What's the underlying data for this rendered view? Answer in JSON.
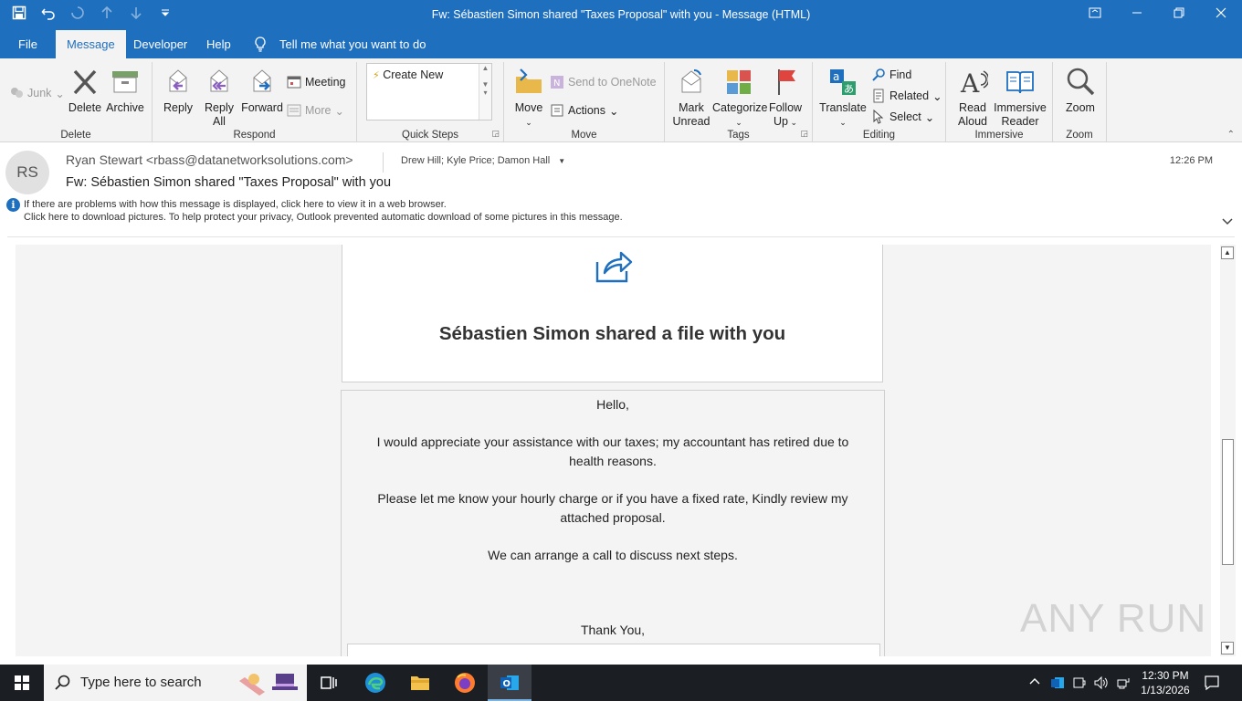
{
  "window": {
    "title": "Fw: Sébastien Simon shared \"Taxes Proposal\" with you  -  Message (HTML)"
  },
  "tabs": [
    {
      "label": "File"
    },
    {
      "label": "Message"
    },
    {
      "label": "Developer"
    },
    {
      "label": "Help"
    },
    {
      "label": "Tell me what you want to do"
    }
  ],
  "ribbon": {
    "groups": {
      "delete": "Delete",
      "respond": "Respond",
      "quicksteps": "Quick Steps",
      "move": "Move",
      "tags": "Tags",
      "editing": "Editing",
      "immersive": "Immersive",
      "zoom": "Zoom"
    },
    "buttons": {
      "junk": "Junk",
      "delete": "Delete",
      "archive": "Archive",
      "reply": "Reply",
      "reply_all_1": "Reply",
      "reply_all_2": "All",
      "forward": "Forward",
      "meeting": "Meeting",
      "more": "More",
      "create_new": "Create New",
      "move": "Move",
      "send_onenote": "Send to OneNote",
      "actions": "Actions",
      "mark_unread_1": "Mark",
      "mark_unread_2": "Unread",
      "categorize": "Categorize",
      "follow_up_1": "Follow",
      "follow_up_2": "Up",
      "translate": "Translate",
      "find": "Find",
      "related": "Related",
      "select": "Select",
      "read_aloud_1": "Read",
      "read_aloud_2": "Aloud",
      "immersive_reader_1": "Immersive",
      "immersive_reader_2": "Reader",
      "zoom": "Zoom"
    }
  },
  "message": {
    "avatar_initials": "RS",
    "from": "Ryan Stewart <rbass@datanetworksolutions.com>",
    "to": "Drew Hill; Kyle Price; Damon Hall",
    "time": "12:26 PM",
    "subject": "Fw: Sébastien Simon shared \"Taxes Proposal\" with you",
    "info_line_1": "If there are problems with how this message is displayed, click here to view it in a web browser.",
    "info_line_2": "Click here to download pictures. To help protect your privacy, Outlook prevented automatic download of some pictures in this message."
  },
  "body": {
    "card_title": "Sébastien Simon shared a file with you",
    "greeting": "Hello,",
    "para1": "I would appreciate your assistance with our taxes; my accountant has retired due to health reasons.",
    "para2": "Please let me know your hourly charge or if you have a fixed rate, Kindly review my attached proposal.",
    "para3": "We can arrange a call to discuss next steps.",
    "closing": "Thank You,"
  },
  "watermark": "ANY RUN",
  "taskbar": {
    "search_placeholder": "Type here to search",
    "clock_time": "12:30 PM",
    "clock_date": "1/13/2026"
  },
  "colors": {
    "accent": "#1f6fbf",
    "taskbar": "#1b1e23"
  }
}
